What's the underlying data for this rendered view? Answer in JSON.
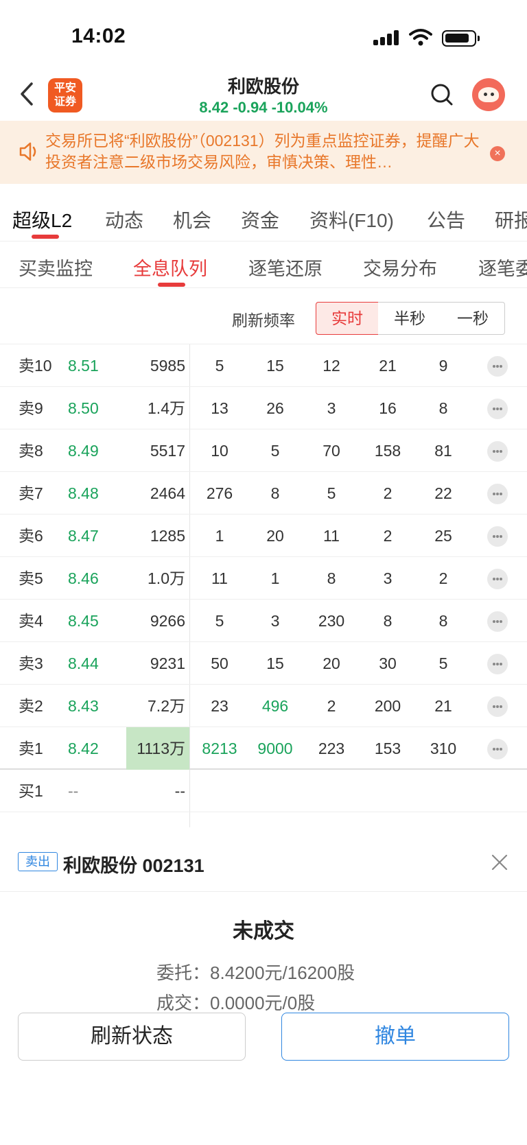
{
  "status_bar": {
    "time": "14:02"
  },
  "header": {
    "logo_line1": "平安",
    "logo_line2": "证券",
    "stock_name": "利欧股份",
    "quote": "8.42 -0.94 -10.04%"
  },
  "notice": {
    "text": "交易所已将“利欧股份”（002131）列为重点监控证券，提醒广大投资者注意二级市场交易风险，审慎决策、理性…",
    "close": "×"
  },
  "main_tabs": [
    "超级L2",
    "动态",
    "机会",
    "资金",
    "资料(F10)",
    "公告",
    "研报"
  ],
  "sub_tabs": [
    "买卖监控",
    "全息队列",
    "逐笔还原",
    "交易分布",
    "逐笔委托"
  ],
  "refresh": {
    "label": "刷新频率",
    "options": [
      "实时",
      "半秒",
      "一秒"
    ],
    "selected": "实时"
  },
  "order_book": {
    "rows": [
      {
        "label": "卖10",
        "price": "8.51",
        "volume": "5985",
        "queue": [
          "5",
          "15",
          "12",
          "21",
          "9"
        ]
      },
      {
        "label": "卖9",
        "price": "8.50",
        "volume": "1.4万",
        "queue": [
          "13",
          "26",
          "3",
          "16",
          "8"
        ]
      },
      {
        "label": "卖8",
        "price": "8.49",
        "volume": "5517",
        "queue": [
          "10",
          "5",
          "70",
          "158",
          "81"
        ]
      },
      {
        "label": "卖7",
        "price": "8.48",
        "volume": "2464",
        "queue": [
          "276",
          "8",
          "5",
          "2",
          "22"
        ]
      },
      {
        "label": "卖6",
        "price": "8.47",
        "volume": "1285",
        "queue": [
          "1",
          "20",
          "11",
          "2",
          "25"
        ]
      },
      {
        "label": "卖5",
        "price": "8.46",
        "volume": "1.0万",
        "queue": [
          "11",
          "1",
          "8",
          "3",
          "2"
        ]
      },
      {
        "label": "卖4",
        "price": "8.45",
        "volume": "9266",
        "queue": [
          "5",
          "3",
          "230",
          "8",
          "8"
        ]
      },
      {
        "label": "卖3",
        "price": "8.44",
        "volume": "9231",
        "queue": [
          "50",
          "15",
          "20",
          "30",
          "5"
        ]
      },
      {
        "label": "卖2",
        "price": "8.43",
        "volume": "7.2万",
        "queue": [
          "23",
          "496",
          "2",
          "200",
          "21"
        ]
      },
      {
        "label": "卖1",
        "price": "8.42",
        "volume": "1113万",
        "queue": [
          "8213",
          "9000",
          "223",
          "153",
          "310"
        ]
      },
      {
        "label": "买1",
        "price": "--",
        "volume": "--",
        "queue": []
      }
    ]
  },
  "order_panel": {
    "side_badge": "卖出",
    "title": "利欧股份 002131",
    "status": "未成交",
    "entrust_label": "委托：",
    "entrust_value": "8.4200元/16200股",
    "deal_label": "成交：",
    "deal_value": "0.0000元/0股",
    "refresh_button": "刷新状态",
    "cancel_button": "撤单"
  },
  "colors": {
    "accent_red": "#e73b3b",
    "down_green": "#1aa35b",
    "blue": "#2f86e0",
    "notice_orange": "#e8772a"
  }
}
